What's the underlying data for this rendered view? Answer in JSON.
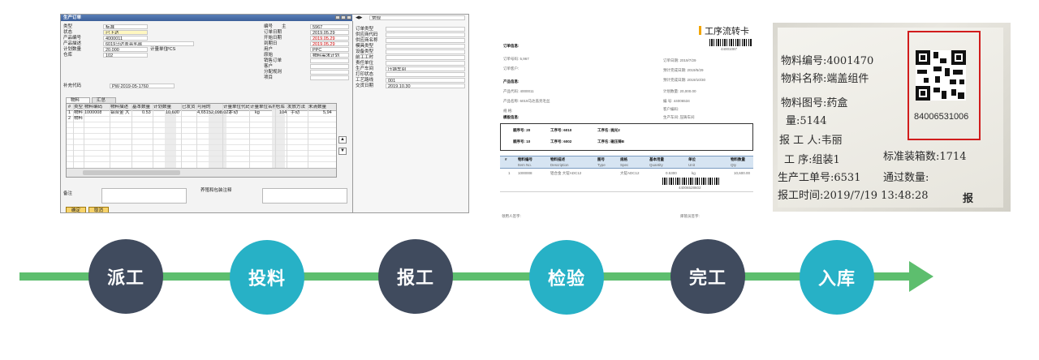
{
  "erp": {
    "title": "生产订单",
    "fields": [
      {
        "label": "类型",
        "value": "标准"
      },
      {
        "label": "状态",
        "value": "已下达"
      },
      {
        "label": "产品编号",
        "value": "4000011"
      },
      {
        "label": "产品描述",
        "value": "6019马达盖亮毛丝"
      },
      {
        "label": "计划数量",
        "value": "20,000",
        "extra_label": "计量单位",
        "extra_value": "PCS"
      },
      {
        "label": "仓库",
        "value": "102"
      }
    ],
    "fields_right": [
      {
        "label": "编号",
        "value": "5967",
        "prefix": "主"
      },
      {
        "label": "订单日期",
        "value": "2019.05.29"
      },
      {
        "label": "开始日期",
        "value": "2019.05.29"
      },
      {
        "label": "到期日",
        "value": "2019.05.29"
      },
      {
        "label": "用户",
        "value": "PPC"
      },
      {
        "label": "原始",
        "value": "物料需求计划"
      },
      {
        "label": "销售订单",
        "value": ""
      },
      {
        "label": "客户",
        "value": ""
      },
      {
        "label": "分配规则",
        "value": ""
      },
      {
        "label": "项目",
        "value": ""
      }
    ],
    "supplement_label": "补充代码",
    "supplement_value": "PW-2019-05-1760",
    "tabs": [
      "物料",
      "汇总"
    ],
    "grid_headers": [
      "#",
      "类型",
      "物料编码",
      "物料描述",
      "基本数量",
      "计划数量",
      "已发货",
      "可用的",
      "计量单位代码",
      "计量单位名称",
      "仓库",
      "发放方法",
      "未清数量"
    ],
    "grid_rows": [
      [
        "1",
        "物料",
        "1000008",
        "铝合金 大",
        "0.53",
        "10,600",
        "",
        "4,651",
        "52,098.022",
        "手动",
        "kg",
        "104",
        "手动",
        "5,94"
      ],
      [
        "2",
        "物料",
        "",
        "",
        "",
        "",
        "",
        "",
        "",
        "",
        "",
        "",
        "",
        ""
      ]
    ],
    "memo_label": "备注",
    "packaging_label": "养殖和包装注释",
    "ok_label": "确定",
    "cancel_label": "取消",
    "right_panel_header": "常规",
    "right_fields": [
      "订单类型",
      "供应商代码",
      "供应商名称",
      "模具类型",
      "设备类型",
      "前工工时",
      "责任单位",
      "生产车间",
      "打印状态",
      "工艺路线",
      "交货日期"
    ],
    "right_values": [
      "",
      "",
      "",
      "",
      "",
      "",
      "",
      "压铸车间",
      "",
      "001",
      "2019.10.30"
    ]
  },
  "card": {
    "title": "工序流转卡",
    "code_top": "44001087",
    "section_order": "订单信息:",
    "order_no": "订单号码: 5,967",
    "customer": "订单客户:",
    "plan_start": "订单日期: 2019/7/29",
    "plan_pending": "预计完成日期: 2019/5/29",
    "plan_end": "预计完成日期: 2019/10/30",
    "section_product": "产品信息:",
    "product_code": "产品代码: 4000011",
    "product_name": "产品名称: 6019马达盖亮毛丝",
    "spec": "规  格:",
    "plan_qty": "计划数量: 20,000.00",
    "unit_no": "编  号: 44006534",
    "customer_code": "客户编码:",
    "section_template": "模板信息:",
    "workshop": "生产车间: 压铸车间",
    "process_rows": [
      {
        "seq": "顺序号: 20",
        "op": "工序号: 6010",
        "name": "工序名: 抛光2"
      },
      {
        "seq": "顺序号: 10",
        "op": "工序号: 6002",
        "name": "工序名: 磁压铸B"
      }
    ],
    "table_headers": [
      "#",
      "物料编号",
      "物料描述",
      "图号",
      "规格",
      "基本用量",
      "单位",
      "物料数量"
    ],
    "table_subheaders": [
      "",
      "Item No.",
      "Description",
      "Type",
      "Spec",
      "Quantity",
      "Unit",
      "Qty"
    ],
    "table_row": [
      "1",
      "1000008",
      "铝合金  大锭ADC12",
      "",
      "大锭ADC12",
      "0.5300",
      "kg",
      "10,600.00"
    ],
    "code_bottom": "44006528602",
    "picker": "领用人签字:",
    "keeper": "库管员签字:"
  },
  "photo": {
    "lines": [
      "物料编号:4001470",
      "物料名称:端盖组件",
      "物料图号:药盒",
      "量:5144",
      "报 工 人:韦丽",
      "工 序:组装1",
      "生产工单号:6531",
      "报工时间:2019/7/19 13:48:28"
    ],
    "qr_code_number": "84006531006",
    "std_box": "标准装箱数:1714",
    "pass_qty": "通过数量:",
    "corner": "报"
  },
  "flow": {
    "steps": [
      {
        "label": "派工",
        "color": "#404b5e"
      },
      {
        "label": "投料",
        "color": "#27b1c6"
      },
      {
        "label": "报工",
        "color": "#404b5e"
      },
      {
        "label": "检验",
        "color": "#27b1c6"
      },
      {
        "label": "完工",
        "color": "#404b5e"
      },
      {
        "label": "入库",
        "color": "#27b1c6"
      }
    ],
    "line_color": "#5dbe6e"
  }
}
